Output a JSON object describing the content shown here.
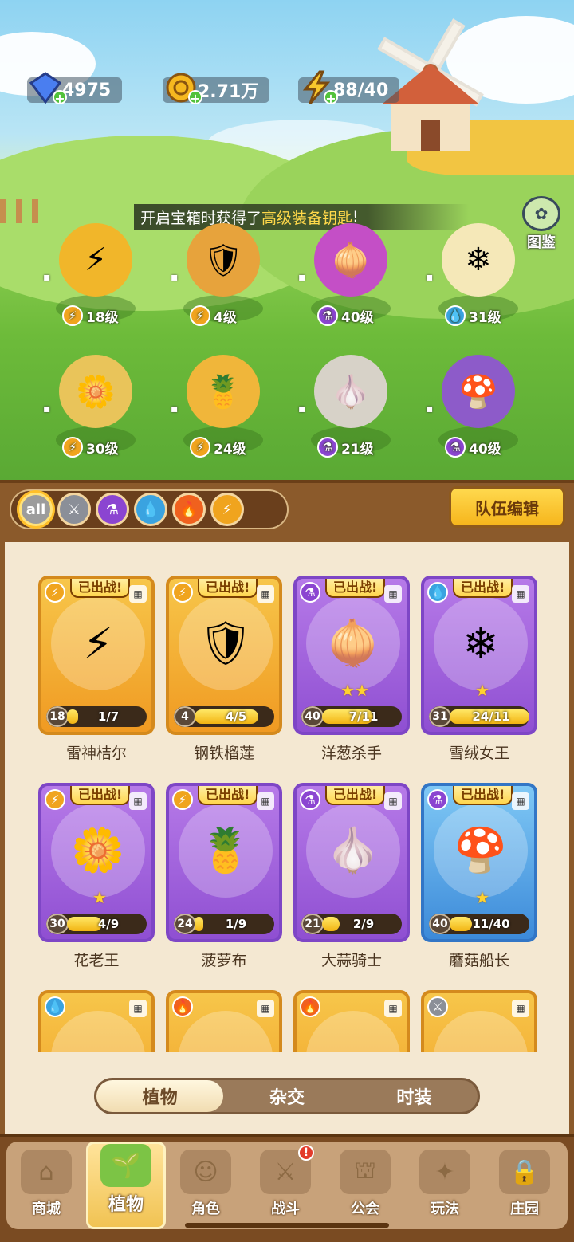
{
  "resources": {
    "diamonds": "4975",
    "coins": "2.71万",
    "energy": "88/40"
  },
  "banner": {
    "prefix": "开启宝箱时获得了",
    "highlight": "高级装备钥匙",
    "suffix": "!"
  },
  "codex": {
    "label": "图鉴"
  },
  "formation": [
    {
      "element": "lightning",
      "level": "18级",
      "icon": "thunder-hero-icon"
    },
    {
      "element": "lightning",
      "level": "4级",
      "icon": "iron-durian-icon"
    },
    {
      "element": "potion",
      "level": "40级",
      "icon": "onion-killer-icon"
    },
    {
      "element": "water",
      "level": "31级",
      "icon": "snow-queen-icon"
    },
    {
      "element": "lightning",
      "level": "30级",
      "icon": "flower-king-icon"
    },
    {
      "element": "lightning",
      "level": "24级",
      "icon": "pineapple-icon"
    },
    {
      "element": "potion",
      "level": "21级",
      "icon": "garlic-knight-icon"
    },
    {
      "element": "potion",
      "level": "40级",
      "icon": "mushroom-captain-icon"
    }
  ],
  "filters": [
    "all",
    "sword",
    "potion",
    "water",
    "fire",
    "lightning"
  ],
  "team_edit": "队伍编辑",
  "deployed_tag": "已出战!",
  "cards": [
    {
      "name": "雷神桔尔",
      "level": "18",
      "progress": "1/7",
      "fraction": 0.14,
      "theme": "gold",
      "element": "lightning",
      "stars": "",
      "glyph": "⚡"
    },
    {
      "name": "钢铁榴莲",
      "level": "4",
      "progress": "4/5",
      "fraction": 0.8,
      "theme": "gold",
      "element": "lightning",
      "stars": "",
      "glyph": "🛡"
    },
    {
      "name": "洋葱杀手",
      "level": "40",
      "progress": "7/11",
      "fraction": 0.64,
      "theme": "purple",
      "element": "potion",
      "stars": "★★",
      "glyph": "🧅"
    },
    {
      "name": "雪绒女王",
      "level": "31",
      "progress": "24/11",
      "fraction": 1.0,
      "theme": "purple",
      "element": "water",
      "stars": "★",
      "glyph": "❄"
    },
    {
      "name": "花老王",
      "level": "30",
      "progress": "4/9",
      "fraction": 0.44,
      "theme": "purple",
      "element": "lightning",
      "stars": "★",
      "glyph": "🌼"
    },
    {
      "name": "菠萝布",
      "level": "24",
      "progress": "1/9",
      "fraction": 0.11,
      "theme": "purple",
      "element": "lightning",
      "stars": "",
      "glyph": "🍍"
    },
    {
      "name": "大蒜骑士",
      "level": "21",
      "progress": "2/9",
      "fraction": 0.22,
      "theme": "purple",
      "element": "potion",
      "stars": "",
      "glyph": "🧄"
    },
    {
      "name": "蘑菇船长",
      "level": "40",
      "progress": "11/40",
      "fraction": 0.28,
      "theme": "blue",
      "element": "potion",
      "stars": "★",
      "glyph": "🍄"
    }
  ],
  "partial_cards": [
    {
      "theme": "gold",
      "element": "water"
    },
    {
      "theme": "gold",
      "element": "fire"
    },
    {
      "theme": "gold",
      "element": "fire"
    },
    {
      "theme": "gold",
      "element": "sword"
    }
  ],
  "segments": [
    "植物",
    "杂交",
    "时装"
  ],
  "nav": [
    {
      "label": "商城",
      "icon": "shop-icon"
    },
    {
      "label": "植物",
      "icon": "plants-icon",
      "active": true
    },
    {
      "label": "角色",
      "icon": "character-icon"
    },
    {
      "label": "战斗",
      "icon": "battle-icon",
      "badge": "!"
    },
    {
      "label": "公会",
      "icon": "guild-icon"
    },
    {
      "label": "玩法",
      "icon": "gameplay-icon"
    },
    {
      "label": "庄园",
      "icon": "manor-lock-icon"
    }
  ],
  "colors": {
    "accent": "#f6b51c",
    "panel_wood": "#8b5a2b",
    "highlight_text": "#ffd84a"
  }
}
